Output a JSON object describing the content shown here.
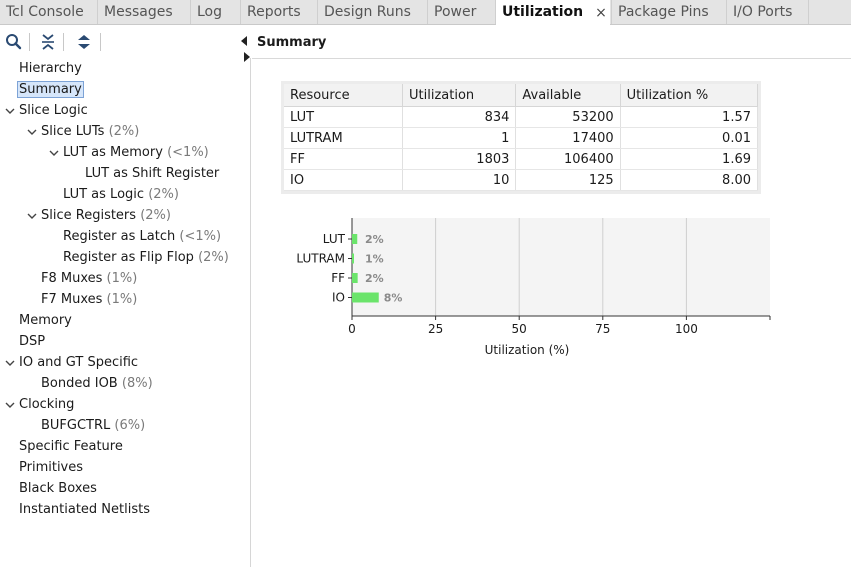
{
  "tabs": [
    {
      "label": "Tcl Console"
    },
    {
      "label": "Messages"
    },
    {
      "label": "Log"
    },
    {
      "label": "Reports"
    },
    {
      "label": "Design Runs"
    },
    {
      "label": "Power"
    },
    {
      "label": "Utilization",
      "active": true
    },
    {
      "label": "Package Pins"
    },
    {
      "label": "I/O Ports"
    }
  ],
  "tab_close_glyph": "×",
  "toolbar_icons": [
    "search-icon",
    "collapse-all-icon",
    "expand-all-icon"
  ],
  "tree": [
    {
      "label": "Hierarchy",
      "pct": ""
    },
    {
      "label": "Summary",
      "pct": "",
      "selected": true
    },
    {
      "label": "Slice Logic",
      "pct": "",
      "expanded": true
    },
    {
      "label": "Slice LUTs",
      "pct": "(2%)",
      "expanded": true
    },
    {
      "label": "LUT as Memory",
      "pct": "(<1%)",
      "expanded": true
    },
    {
      "label": "LUT as Shift Register",
      "pct": ""
    },
    {
      "label": "LUT as Logic",
      "pct": "(2%)"
    },
    {
      "label": "Slice Registers",
      "pct": "(2%)",
      "expanded": true
    },
    {
      "label": "Register as Latch",
      "pct": "(<1%)"
    },
    {
      "label": "Register as Flip Flop",
      "pct": "(2%)"
    },
    {
      "label": "F8 Muxes",
      "pct": "(1%)"
    },
    {
      "label": "F7 Muxes",
      "pct": "(1%)"
    },
    {
      "label": "Memory",
      "pct": ""
    },
    {
      "label": "DSP",
      "pct": ""
    },
    {
      "label": "IO and GT Specific",
      "pct": "",
      "expanded": true
    },
    {
      "label": "Bonded IOB",
      "pct": "(8%)"
    },
    {
      "label": "Clocking",
      "pct": "",
      "expanded": true
    },
    {
      "label": "BUFGCTRL",
      "pct": "(6%)"
    },
    {
      "label": "Specific Feature",
      "pct": ""
    },
    {
      "label": "Primitives",
      "pct": ""
    },
    {
      "label": "Black Boxes",
      "pct": ""
    },
    {
      "label": "Instantiated Netlists",
      "pct": ""
    }
  ],
  "summary": {
    "title": "Summary",
    "headers": [
      "Resource",
      "Utilization",
      "Available",
      "Utilization %"
    ],
    "rows": [
      [
        "LUT",
        "834",
        "53200",
        "1.57"
      ],
      [
        "LUTRAM",
        "1",
        "17400",
        "0.01"
      ],
      [
        "FF",
        "1803",
        "106400",
        "1.69"
      ],
      [
        "IO",
        "10",
        "125",
        "8.00"
      ]
    ]
  },
  "chart_data": {
    "type": "bar",
    "orientation": "horizontal",
    "categories": [
      "LUT",
      "LUTRAM",
      "FF",
      "IO"
    ],
    "values": [
      1.57,
      0.01,
      1.69,
      8.0
    ],
    "data_labels": [
      "2%",
      "1%",
      "2%",
      "8%"
    ],
    "xlabel": "Utilization (%)",
    "ylabel": "",
    "xlim": [
      0,
      125
    ],
    "xticks": [
      0,
      25,
      50,
      75,
      100
    ],
    "grid": true,
    "colors": {
      "bar": "#6be46b",
      "plot_bg": "#f4f4f4",
      "grid": "#cfcfcf",
      "label": "#8a8a8a"
    }
  }
}
